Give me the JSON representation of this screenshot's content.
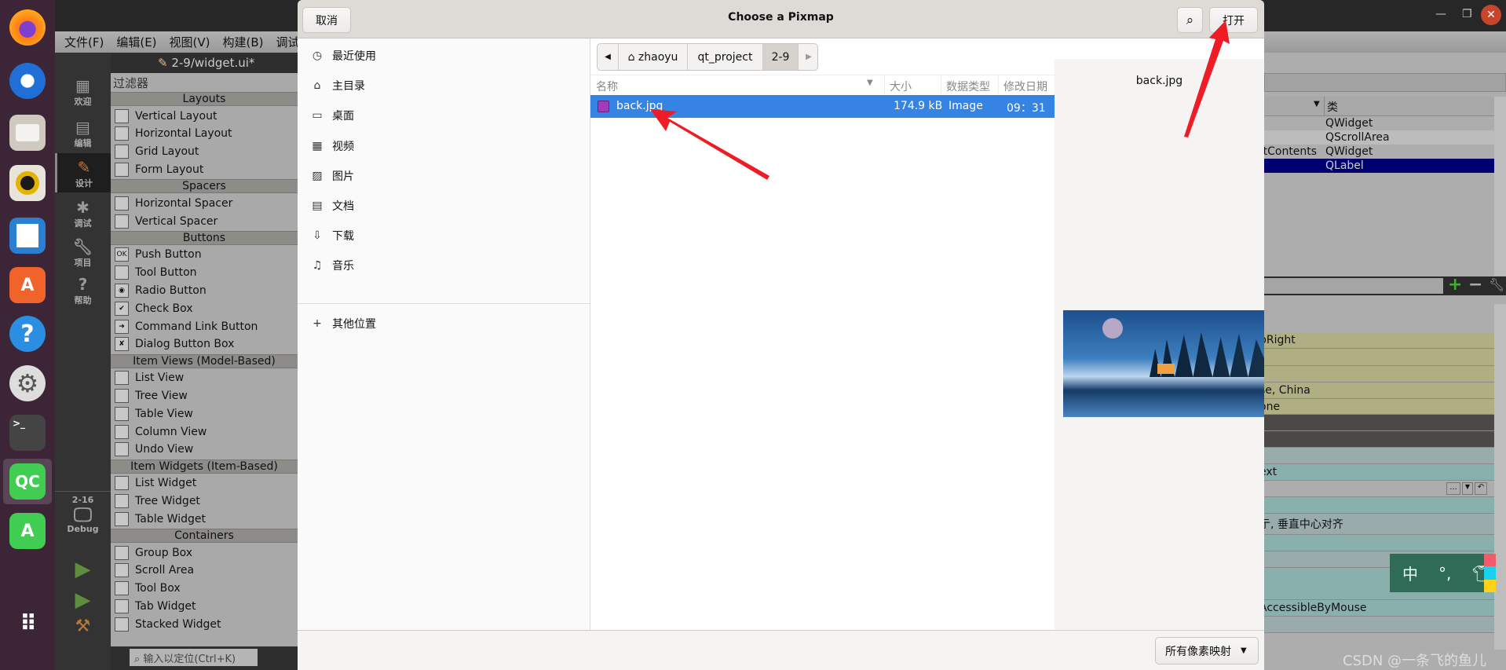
{
  "dock": {
    "items": [
      "firefox-icon",
      "thunderbird-icon",
      "files-icon",
      "rhythmbox-icon",
      "writer-icon",
      "software-icon",
      "help-icon",
      "settings-icon",
      "terminal-icon",
      "qtcreator-icon",
      "qt-designer-icon",
      "app-grid-icon"
    ],
    "qc_label": "QC",
    "a_label": "A"
  },
  "qt": {
    "menu": [
      "文件(F)",
      "编辑(E)",
      "视图(V)",
      "构建(B)",
      "调试(D"
    ],
    "file_tab": "2-9/widget.ui*",
    "modes": [
      {
        "label": "欢迎",
        "icon": "grid-icon"
      },
      {
        "label": "编辑",
        "icon": "edit-icon"
      },
      {
        "label": "设计",
        "icon": "pencil-icon"
      },
      {
        "label": "调试",
        "icon": "bug-icon"
      },
      {
        "label": "项目",
        "icon": "wrench-icon"
      },
      {
        "label": "帮助",
        "icon": "help-icon"
      }
    ],
    "kit": {
      "project": "2-16",
      "config": "Debug"
    },
    "filter_label": "过滤器",
    "widget_box": [
      {
        "header": "Layouts",
        "items": [
          "Vertical Layout",
          "Horizontal Layout",
          "Grid Layout",
          "Form Layout"
        ]
      },
      {
        "header": "Spacers",
        "items": [
          "Horizontal Spacer",
          "Vertical Spacer"
        ]
      },
      {
        "header": "Buttons",
        "items": [
          "Push Button",
          "Tool Button",
          "Radio Button",
          "Check Box",
          "Command Link Button",
          "Dialog Button Box"
        ]
      },
      {
        "header": "Item Views (Model-Based)",
        "items": [
          "List View",
          "Tree View",
          "Table View",
          "Column View",
          "Undo View"
        ]
      },
      {
        "header": "Item Widgets (Item-Based)",
        "items": [
          "List Widget",
          "Tree Widget",
          "Table Widget"
        ]
      },
      {
        "header": "Containers",
        "items": [
          "Group Box",
          "Scroll Area",
          "Tool Box",
          "Tab Widget",
          "Stacked Widget"
        ]
      }
    ],
    "locator_placeholder": "输入以定位(Ctrl+K)",
    "object_inspector": {
      "class_header": "类",
      "rows": [
        {
          "object": "",
          "class": "QWidget"
        },
        {
          "object": "",
          "class": "QScrollArea"
        },
        {
          "object": "etContents",
          "class": "QWidget"
        },
        {
          "object": "",
          "class": "QLabel",
          "selected": true
        }
      ]
    },
    "properties": [
      "pRight",
      "",
      "",
      "se, China",
      "one",
      "",
      "",
      "",
      "ext",
      "",
      "",
      "亍, 垂直中心对齐",
      "",
      "",
      "",
      "AccessibleByMouse",
      ""
    ],
    "property_button": "..."
  },
  "dialog": {
    "title": "Choose a Pixmap",
    "cancel": "取消",
    "open": "打开",
    "places": [
      {
        "label": "最近使用",
        "icon": "recent-icon"
      },
      {
        "label": "主目录",
        "icon": "home-icon"
      },
      {
        "label": "桌面",
        "icon": "desktop-icon"
      },
      {
        "label": "视频",
        "icon": "video-icon"
      },
      {
        "label": "图片",
        "icon": "pictures-icon"
      },
      {
        "label": "文档",
        "icon": "documents-icon"
      },
      {
        "label": "下载",
        "icon": "download-icon"
      },
      {
        "label": "音乐",
        "icon": "music-icon"
      }
    ],
    "other_locations": "其他位置",
    "path": [
      "zhaoyu",
      "qt_project",
      "2-9"
    ],
    "columns": {
      "name": "名称",
      "size": "大小",
      "type": "数据类型",
      "modified": "修改日期"
    },
    "files": [
      {
        "name": "back.jpg",
        "size": "174.9 kB",
        "type": "Image",
        "modified": "09：31",
        "selected": true
      }
    ],
    "preview_name": "back.jpg",
    "filter": "所有像素映射",
    "selection_color": "#3584e4"
  },
  "ime": {
    "lang": "中",
    "punct": "°,",
    "skin": "shirt-icon"
  },
  "watermark": "CSDN @一条飞的鱼儿"
}
